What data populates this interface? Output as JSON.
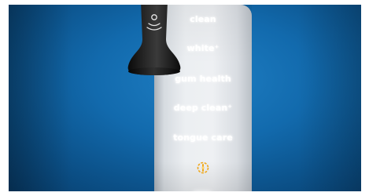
{
  "modes": {
    "mode_1": "clean",
    "mode_2": "white⁺",
    "mode_3": "gum health",
    "mode_4": "deep clean⁺",
    "mode_5": "tongue care"
  },
  "colors": {
    "background": "#126aad",
    "handle": "#eceff2",
    "brush_head": "#1b1b1b",
    "mode_text": "#ffffff",
    "indicator_icon": "#f0a81c"
  },
  "icons": {
    "brush_head_logo": "sonic-waves-icon",
    "indicator": "brushsync-sensor-icon"
  }
}
